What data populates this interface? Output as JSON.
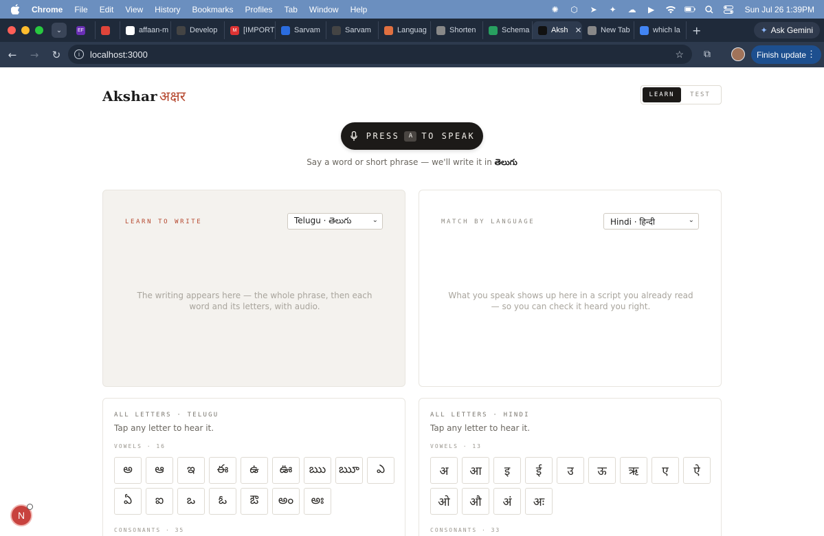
{
  "menubar": {
    "app": "Chrome",
    "items": [
      "File",
      "Edit",
      "View",
      "History",
      "Bookmarks",
      "Profiles",
      "Tab",
      "Window",
      "Help"
    ],
    "clock": "Sun Jul 26  1:39PM"
  },
  "tabs": [
    {
      "label": "",
      "fav": "EF",
      "color": "#6a2fb5"
    },
    {
      "label": "",
      "fav": "",
      "color": "#e0453a"
    },
    {
      "label": "affaan-m",
      "fav": "",
      "color": "#ffffff"
    },
    {
      "label": "Develop",
      "fav": "",
      "color": "#444"
    },
    {
      "label": "[IMPORT",
      "fav": "M",
      "color": "#d33"
    },
    {
      "label": "Sarvam",
      "fav": "",
      "color": "#2b6de0"
    },
    {
      "label": "Sarvam",
      "fav": "",
      "color": "#444"
    },
    {
      "label": "Languag",
      "fav": "",
      "color": "#e07040"
    },
    {
      "label": "Shorten",
      "fav": "",
      "color": "#888"
    },
    {
      "label": "Schema",
      "fav": "",
      "color": "#28a060"
    },
    {
      "label": "Aksh",
      "fav": "",
      "color": "#111",
      "active": true
    },
    {
      "label": "New Tab",
      "fav": "",
      "color": "#888"
    },
    {
      "label": "which la",
      "fav": "",
      "color": "#4285f4"
    }
  ],
  "gemini_label": "Ask Gemini",
  "toolbar": {
    "url": "localhost:3000",
    "finish_update": "Finish update"
  },
  "app": {
    "logo": "Akshar",
    "logo_deva": "अक्षर",
    "modes": [
      "LEARN",
      "TEST"
    ],
    "active_mode": "LEARN",
    "speak": {
      "press": "PRESS",
      "key": "A",
      "to_speak": "TO SPEAK",
      "hint_prefix": "Say a word or short phrase — we'll write it in",
      "hint_script": "తెలుగు"
    },
    "learn_card": {
      "label": "LEARN TO WRITE",
      "select": "Telugu · తెలుగు",
      "empty": "The writing appears here — the whole phrase, then each word and its letters, with audio."
    },
    "match_card": {
      "label": "MATCH BY LANGUAGE",
      "select": "Hindi · हिन्दी",
      "empty": "What you speak shows up here in a script you already read — so you can check it heard you right."
    },
    "telugu_letters": {
      "heading": "ALL LETTERS · TELUGU",
      "sub": "Tap any letter to hear it.",
      "vowels_label": "VOWELS · 16",
      "vowels": [
        "అ",
        "ఆ",
        "ఇ",
        "ఈ",
        "ఉ",
        "ఊ",
        "ఋ",
        "ౠ",
        "ఎ",
        "ఏ",
        "ఐ",
        "ఒ",
        "ఓ",
        "ఔ",
        "అం",
        "అః"
      ],
      "consonants_label": "CONSONANTS · 35"
    },
    "hindi_letters": {
      "heading": "ALL LETTERS · HINDI",
      "sub": "Tap any letter to hear it.",
      "vowels_label": "VOWELS · 13",
      "vowels": [
        "अ",
        "आ",
        "इ",
        "ई",
        "उ",
        "ऊ",
        "ऋ",
        "ए",
        "ऐ",
        "ओ",
        "औ",
        "अं",
        "अः"
      ],
      "consonants_label": "CONSONANTS · 33"
    },
    "fab_letter": "N"
  }
}
